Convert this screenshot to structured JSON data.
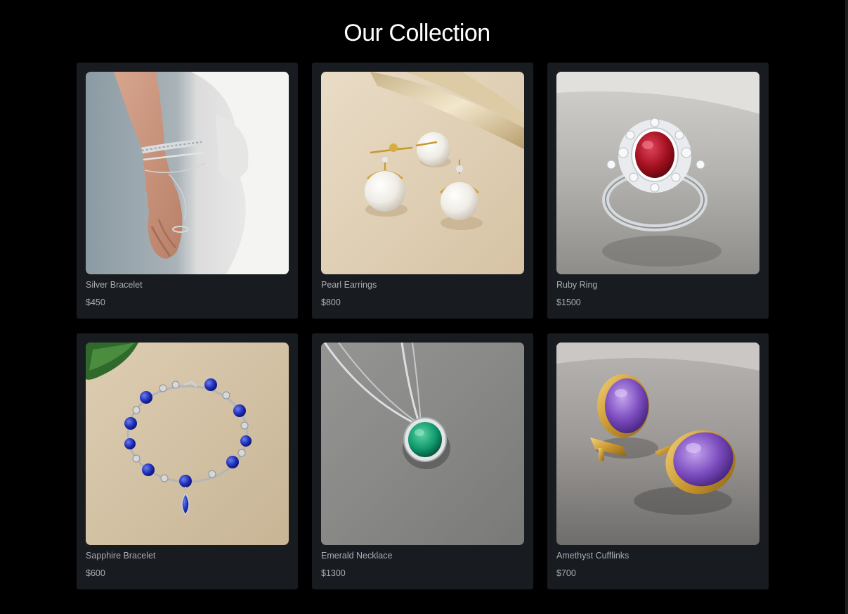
{
  "page": {
    "title": "Our Collection",
    "background": "#000000"
  },
  "products": [
    {
      "name": "Silver Bracelet",
      "price": "$450",
      "image": "silver-bracelet-on-wrist-photo"
    },
    {
      "name": "Pearl Earrings",
      "price": "$800",
      "image": "pearl-earrings-photo"
    },
    {
      "name": "Ruby Ring",
      "price": "$1500",
      "image": "ruby-ring-photo"
    },
    {
      "name": "Sapphire Bracelet",
      "price": "$600",
      "image": "sapphire-bracelet-photo"
    },
    {
      "name": "Emerald Necklace",
      "price": "$1300",
      "image": "emerald-necklace-photo"
    },
    {
      "name": "Amethyst Cufflinks",
      "price": "$700",
      "image": "amethyst-cufflinks-photo"
    }
  ],
  "colors": {
    "card_background": "#181b1f",
    "title_text": "#ffffff",
    "caption_text": "#a9adb3"
  }
}
